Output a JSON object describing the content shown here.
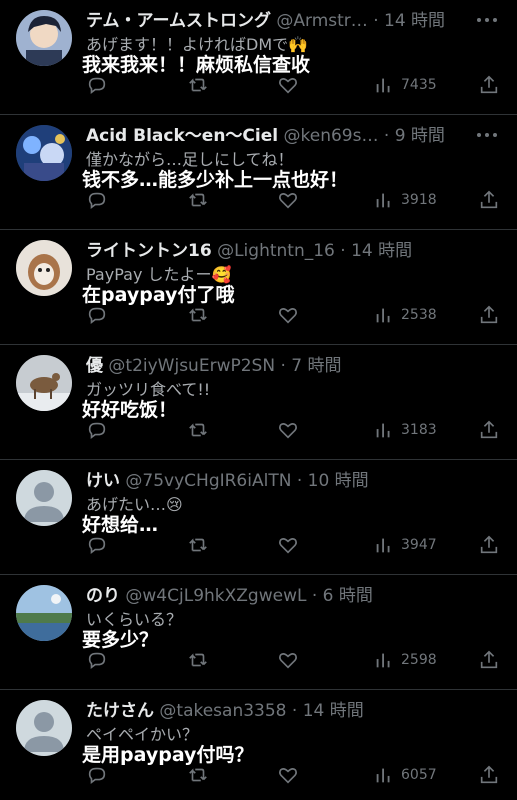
{
  "replies": [
    {
      "name": "テム・アームストロング",
      "handle": "@Armstr…",
      "sep": "·",
      "time": "14 時間",
      "text": "あげます！！よければDMで🙌",
      "subtitle": "我来我来！！麻烦私信查收",
      "views": "7435",
      "avatar_color": "#8aa3c7"
    },
    {
      "name": "Acid Black～en～Ciel",
      "handle": "@ken69s…",
      "sep": "·",
      "time": "9 時間",
      "text": "僅かながら…足しにしてね！",
      "subtitle": "钱不多…能多少补上一点也好！",
      "views": "3918",
      "avatar_color": "#2b4a8c"
    },
    {
      "name": "ライトントン16",
      "handle": "@Lightntn_16",
      "sep": "·",
      "time": "14 時間",
      "text": "PayPay したよー🥰",
      "subtitle": "在paypay付了哦",
      "views": "2538",
      "avatar_color": "#c9a27a"
    },
    {
      "name": "優",
      "handle": "@t2iyWjsuErwP2SN",
      "sep": "·",
      "time": "7 時間",
      "text": "ガッツリ食べて!!",
      "subtitle": "好好吃饭！",
      "views": "3183",
      "avatar_color": "#8c7a66"
    },
    {
      "name": "けい",
      "handle": "@75vyCHgIR6iAlTN",
      "sep": "·",
      "time": "10 時間",
      "text": "あげたい…😢",
      "subtitle": "好想给…",
      "views": "3947",
      "avatar_color": "#cfd9de"
    },
    {
      "name": "のり",
      "handle": "@w4CjL9hkXZgwewL",
      "sep": "·",
      "time": "6 時間",
      "text": "いくらいる？",
      "subtitle": "要多少？",
      "views": "2598",
      "avatar_color": "#6f93b8"
    },
    {
      "name": "たけさん",
      "handle": "@takesan3358",
      "sep": "·",
      "time": "14 時間",
      "text": "ペイペイかい？",
      "subtitle": "是用paypay付吗？",
      "views": "6057",
      "avatar_color": "#cfd9de"
    }
  ],
  "icons": {
    "reply": "reply-icon",
    "retweet": "retweet-icon",
    "like": "heart-icon",
    "views": "views-icon",
    "share": "share-icon",
    "more": "more-icon"
  }
}
